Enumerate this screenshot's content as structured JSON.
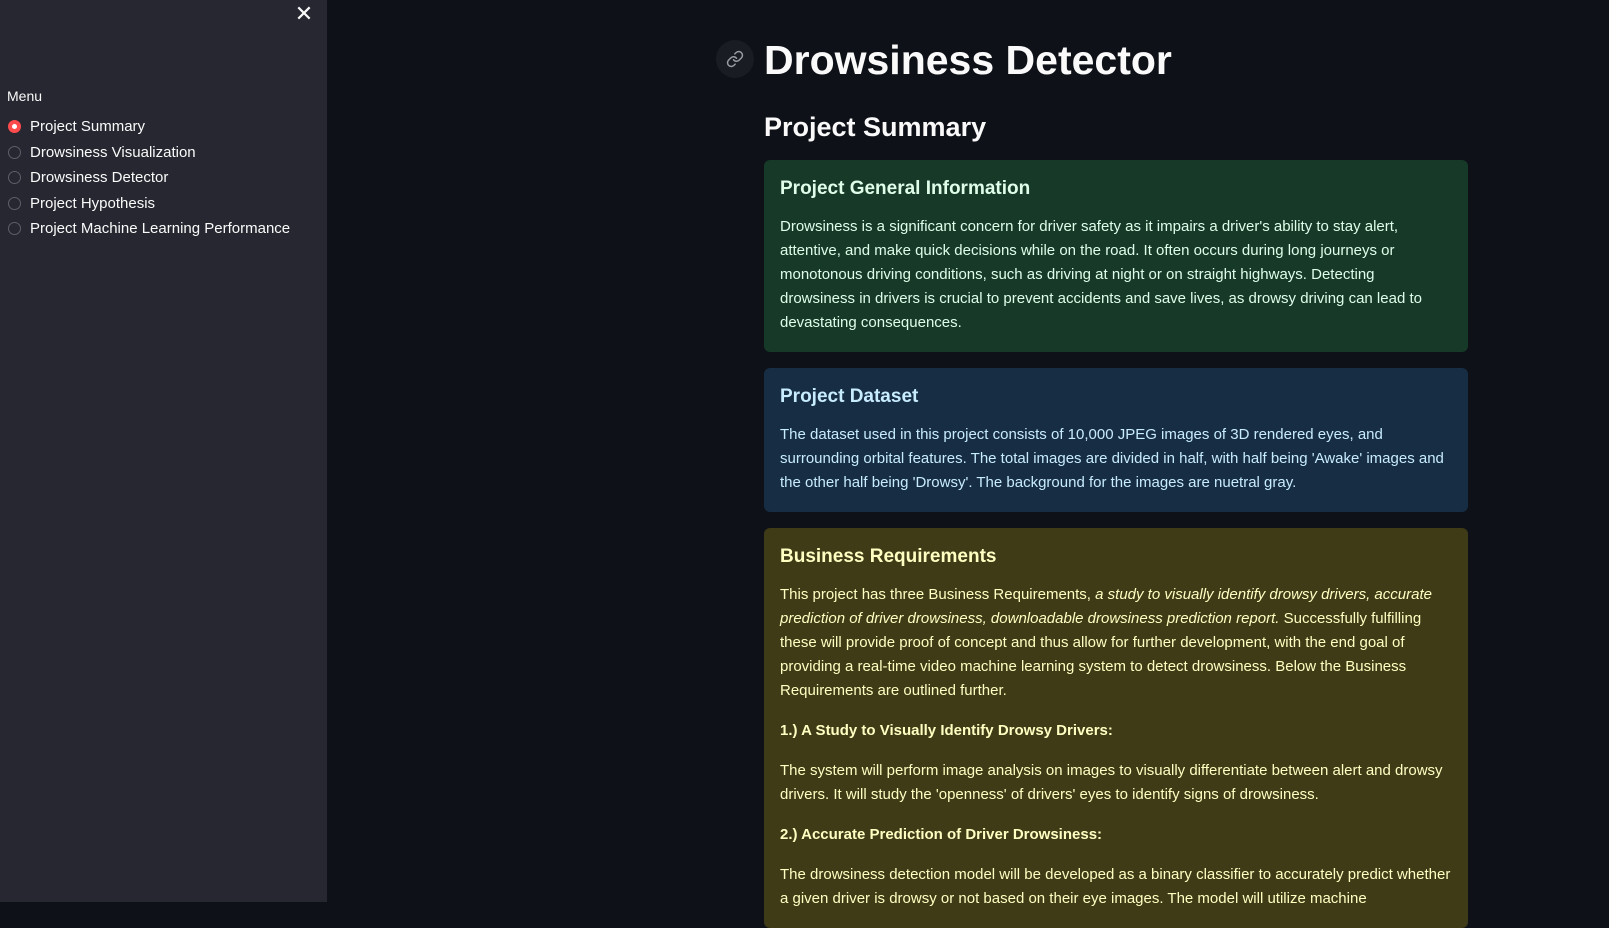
{
  "sidebar": {
    "close_glyph": "✕",
    "menu_label": "Menu",
    "items": [
      {
        "label": "Project Summary",
        "selected": true
      },
      {
        "label": "Drowsiness Visualization",
        "selected": false
      },
      {
        "label": "Drowsiness Detector",
        "selected": false
      },
      {
        "label": "Project Hypothesis",
        "selected": false
      },
      {
        "label": "Project Machine Learning Performance",
        "selected": false
      }
    ]
  },
  "main": {
    "title": "Drowsiness Detector",
    "section_title": "Project Summary",
    "cards": {
      "general": {
        "title": "Project General Information",
        "body": "Drowsiness is a significant concern for driver safety as it impairs a driver's ability to stay alert, attentive, and make quick decisions while on the road. It often occurs during long journeys or monotonous driving conditions, such as driving at night or on straight highways. Detecting drowsiness in drivers is crucial to prevent accidents and save lives, as drowsy driving can lead to devastating consequences."
      },
      "dataset": {
        "title": "Project Dataset",
        "body": "The dataset used in this project consists of 10,000 JPEG images of 3D rendered eyes, and surrounding orbital features. The total images are divided in half, with half being 'Awake' images and the other half being 'Drowsy'. The background for the images are nuetral gray."
      },
      "business": {
        "title": "Business Requirements",
        "intro_start": "This project has three Business Requirements, ",
        "intro_italic": "a study to visually identify drowsy drivers, accurate prediction of driver drowsiness, downloadable drowsiness prediction report.",
        "intro_end": " Successfully fulfilling these will provide proof of concept and thus allow for further development, with the end goal of providing a real-time video machine learning system to detect drowsiness. Below the Business Requirements are outlined further.",
        "req1_title": "1.) A Study to Visually Identify Drowsy Drivers:",
        "req1_body": "The system will perform image analysis on images to visually differentiate between alert and drowsy drivers. It will study the 'openness' of drivers' eyes to identify signs of drowsiness.",
        "req2_title": "2.) Accurate Prediction of Driver Drowsiness:",
        "req2_body": "The drowsiness detection model will be developed as a binary classifier to accurately predict whether a given driver is drowsy or not based on their eye images. The model will utilize machine"
      }
    }
  },
  "colors": {
    "app_background": "#0e1117",
    "sidebar_background": "#262730",
    "accent_radio": "#ff4b4b",
    "card_green": "#173928",
    "card_blue": "#172d43",
    "card_yellow": "#3e3b16"
  },
  "icons": {
    "close": "close-icon",
    "anchor": "link-icon"
  }
}
